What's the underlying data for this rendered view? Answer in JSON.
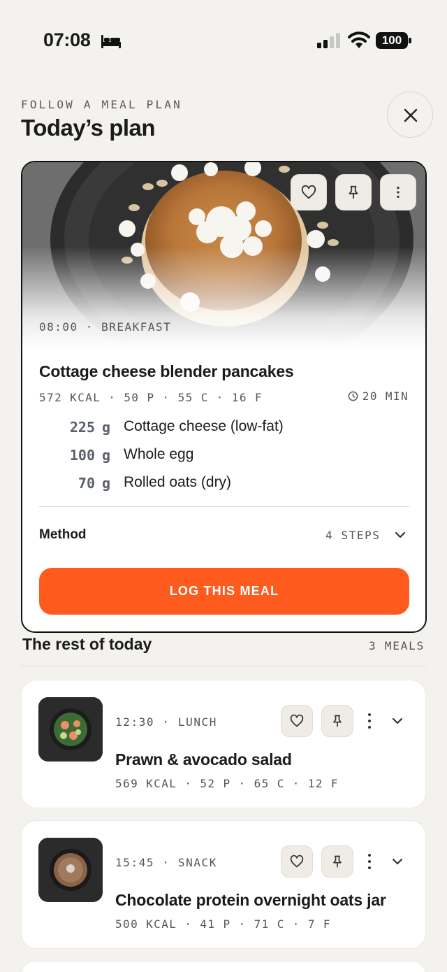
{
  "status_bar": {
    "time": "07:08",
    "battery": "100"
  },
  "header": {
    "eyebrow": "FOLLOW A MEAL PLAN",
    "title": "Today’s plan"
  },
  "featured": {
    "meta": "08:00 · BREAKFAST",
    "name": "Cottage cheese blender pancakes",
    "macros": "572 KCAL · 50 P · 55 C · 16 F",
    "duration": "20 MIN",
    "ingredients": [
      {
        "qty": "225",
        "unit": "g",
        "name": "Cottage cheese (low-fat)"
      },
      {
        "qty": "100",
        "unit": "g",
        "name": "Whole egg"
      },
      {
        "qty": "70",
        "unit": "g",
        "name": "Rolled oats (dry)"
      }
    ],
    "method_label": "Method",
    "method_steps": "4 STEPS",
    "cta": "LOG THIS MEAL"
  },
  "rest": {
    "title": "The rest of today",
    "count": "3 MEALS",
    "meals": [
      {
        "meta": "12:30 · LUNCH",
        "name": "Prawn & avocado salad",
        "macros": "569 KCAL · 52 P · 65 C · 12 F"
      },
      {
        "meta": "15:45 · SNACK",
        "name": "Chocolate protein overnight oats jar",
        "macros": "500 KCAL · 41 P · 71 C · 7 F"
      }
    ]
  },
  "colors": {
    "accent": "#ff5b1f",
    "background": "#f4f2ee"
  }
}
